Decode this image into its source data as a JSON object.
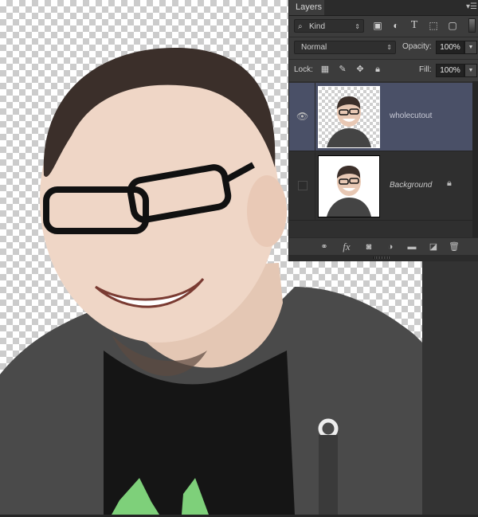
{
  "canvas": {
    "description": "Cutout portrait of a smiling man with glasses wearing a grey hoodie on transparent checkerboard background"
  },
  "panel": {
    "tab_label": "Layers",
    "filter": {
      "kind_label": "Kind",
      "icons": [
        "image-filter-icon",
        "adjustment-filter-icon",
        "type-filter-icon",
        "shape-filter-icon",
        "smart-object-filter-icon"
      ]
    },
    "blend_mode": "Normal",
    "opacity_label": "Opacity:",
    "opacity_value": "100%",
    "lock_label": "Lock:",
    "fill_label": "Fill:",
    "fill_value": "100%",
    "layers": [
      {
        "name": "wholecutout",
        "visible": true,
        "selected": true,
        "locked": false
      },
      {
        "name": "Background",
        "visible": false,
        "selected": false,
        "locked": true
      }
    ],
    "footer_icons": [
      "link-layers-icon",
      "fx-icon",
      "add-mask-icon",
      "adjustment-layer-icon",
      "new-group-icon",
      "new-layer-icon",
      "delete-layer-icon"
    ],
    "fx_label": "fx"
  },
  "colors": {
    "selected_layer": "#4a5067",
    "panel_bg": "#3c3c3c",
    "workspace_bg": "#333333"
  }
}
